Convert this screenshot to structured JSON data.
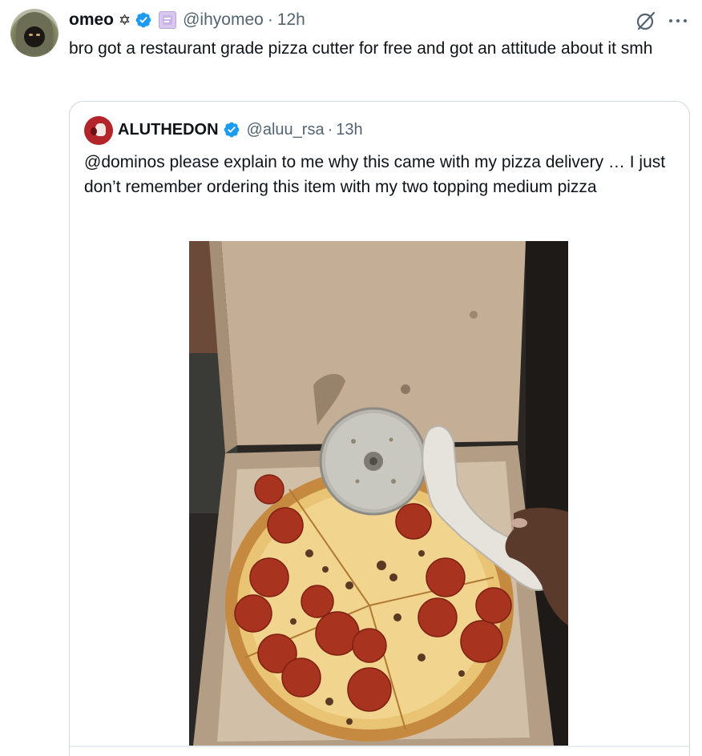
{
  "author": {
    "name": "omeo",
    "name_emoji": "✡",
    "handle": "@ihyomeo",
    "separator": "·",
    "time": "12h",
    "text": "bro got a restaurant grade pizza cutter for free and got an attitude about it smh"
  },
  "quoted": {
    "name": "ALUTHEDON",
    "handle": "@aluu_rsa",
    "separator": "·",
    "time": "13h",
    "text": "@dominos  please explain to me why this came with my pizza delivery … I just don’t remember ordering this item with my two topping medium pizza"
  },
  "icons": {
    "verified": "verified-badge-icon",
    "affiliate": "affiliate-badge-icon",
    "grok": "grok-icon",
    "more": "more-icon"
  },
  "colors": {
    "verified_blue": "#1d9bf0",
    "secondary_text": "#536471",
    "primary_text": "#0f1419",
    "border": "#cfd9de"
  }
}
